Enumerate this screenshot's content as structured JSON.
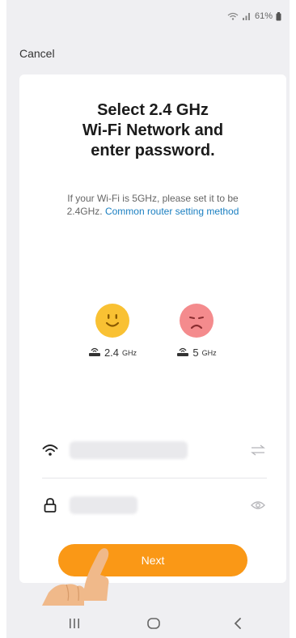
{
  "status_bar": {
    "battery_percent": "61%"
  },
  "header": {
    "cancel_label": "Cancel"
  },
  "main": {
    "title_lines": [
      "Select 2.4 GHz",
      "Wi-Fi Network and",
      "enter password."
    ],
    "description_text": "If your Wi-Fi is 5GHz, please set it to be 2.4GHz.",
    "link_text": "Common router setting method",
    "bands": [
      {
        "value": "2.4",
        "unit": "GHz",
        "face_icon": "smiley-happy-icon"
      },
      {
        "value": "5",
        "unit": "GHz",
        "face_icon": "smiley-sad-icon"
      }
    ],
    "wifi_field": {
      "icon": "wifi-icon",
      "value": "",
      "swap_icon": "swap-arrows-icon"
    },
    "password_field": {
      "icon": "lock-icon",
      "value": "",
      "reveal_icon": "eye-icon"
    },
    "next_label": "Next"
  },
  "colors": {
    "accent": "#fa9816",
    "link": "#1a7fc1",
    "happy_face": "#f9c133",
    "sad_face": "#f48b8d"
  }
}
